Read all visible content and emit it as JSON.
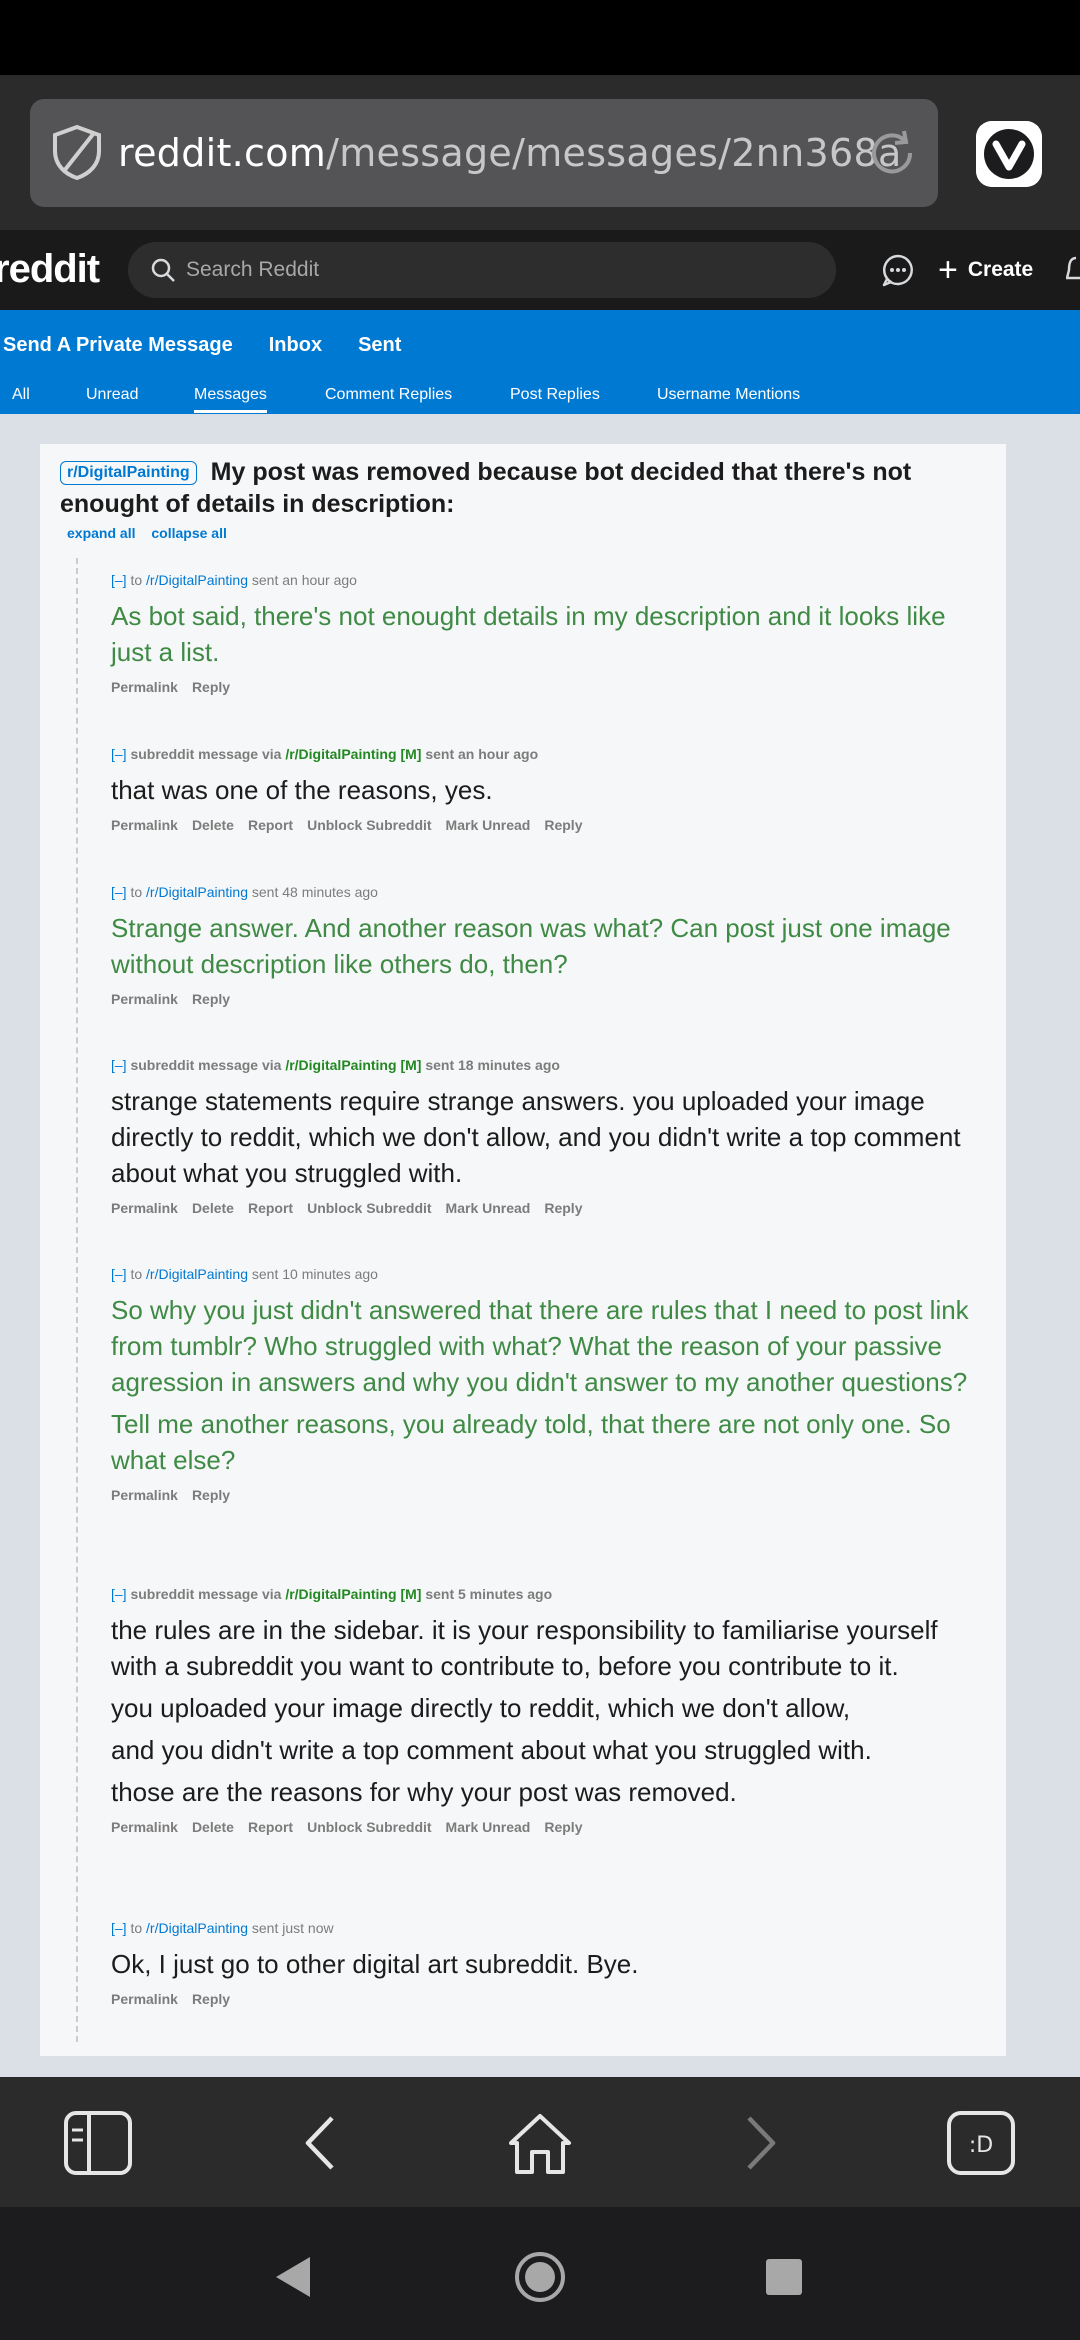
{
  "browser": {
    "url_host": "reddit.com",
    "url_path": "/message/messages/2nn368a"
  },
  "header": {
    "logo": "reddit",
    "search_placeholder": "Search Reddit",
    "create_label": "Create"
  },
  "message_tabs": [
    "Send A Private Message",
    "Inbox",
    "Sent"
  ],
  "sub_tabs": [
    "All",
    "Unread",
    "Messages",
    "Comment Replies",
    "Post Replies",
    "Username Mentions"
  ],
  "active_sub_tab": "Messages",
  "thread": {
    "subreddit_badge": "r/DigitalPainting",
    "title": "My post was removed because bot decided that there's not enought of details in description:",
    "expand_all": "expand all",
    "collapse_all": "collapse all"
  },
  "labels": {
    "toggle": "[–]",
    "to": "to",
    "subreddit_message_via": "subreddit message via",
    "mod_tag": "[M]",
    "subreddit": "/r/DigitalPainting"
  },
  "messages": [
    {
      "time": "sent an hour ago",
      "paragraphs": [
        "As bot said, there's not enought details in my description and it looks like just a list."
      ],
      "actions": [
        "Permalink",
        "Reply"
      ]
    },
    {
      "time": "sent an hour ago",
      "paragraphs": [
        "that was one of the reasons, yes."
      ],
      "actions": [
        "Permalink",
        "Delete",
        "Report",
        "Unblock Subreddit",
        "Mark Unread",
        "Reply"
      ]
    },
    {
      "time": "sent 48 minutes ago",
      "paragraphs": [
        "Strange answer. And another reason was what? Can post just one image without description like others do, then?"
      ],
      "actions": [
        "Permalink",
        "Reply"
      ]
    },
    {
      "time": "sent 18 minutes ago",
      "paragraphs": [
        "strange statements require strange answers. you uploaded your image directly to reddit, which we don't allow, and you didn't write a top comment about what you struggled with."
      ],
      "actions": [
        "Permalink",
        "Delete",
        "Report",
        "Unblock Subreddit",
        "Mark Unread",
        "Reply"
      ]
    },
    {
      "time": "sent 10 minutes ago",
      "paragraphs": [
        "So why you just didn't answered that there are rules that I need to post link from tumblr? Who struggled with what? What the reason of your passive agression in answers and why you didn't answer to my another questions?",
        "Tell me another reasons, you already told, that there are not only one. So what else?"
      ],
      "actions": [
        "Permalink",
        "Reply"
      ]
    },
    {
      "time": "sent 5 minutes ago",
      "paragraphs": [
        "the rules are in the sidebar. it is your responsibility to familiarise yourself with a subreddit you want to contribute to, before you contribute to it.",
        "you uploaded your image directly to reddit, which we don't allow,",
        "and you didn't write a top comment about what you struggled with.",
        "those are the reasons for why your post was removed."
      ],
      "actions": [
        "Permalink",
        "Delete",
        "Report",
        "Unblock Subreddit",
        "Mark Unread",
        "Reply"
      ]
    },
    {
      "time": "sent just now",
      "paragraphs": [
        "Ok, I just go to other digital art subreddit. Bye."
      ],
      "actions": [
        "Permalink",
        "Reply"
      ]
    }
  ],
  "colors": {
    "reddit_blue": "#0079d3",
    "user_message_green": "#3f8a45",
    "mod_green": "#228822"
  }
}
